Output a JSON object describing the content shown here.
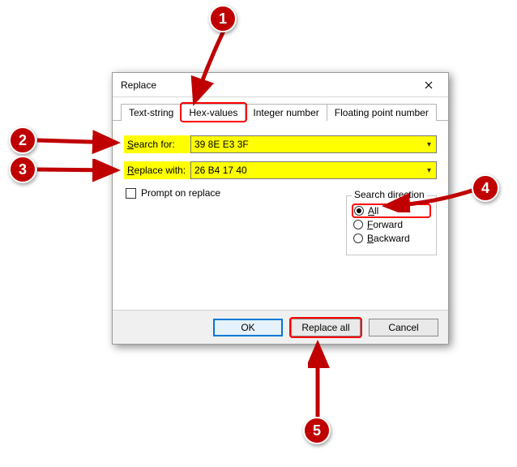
{
  "dialog": {
    "title": "Replace",
    "tabs": [
      {
        "label": "Text-string"
      },
      {
        "label": "Hex-values"
      },
      {
        "label": "Integer number"
      },
      {
        "label": "Floating point number"
      }
    ],
    "search_label_prefix": "S",
    "search_label_rest": "earch for:",
    "search_value": "39 8E E3 3F",
    "replace_label_prefix": "R",
    "replace_label_rest": "eplace with:",
    "replace_value": "26 B4 17 40",
    "prompt_label": "Prompt on replace",
    "prompt_checked": false,
    "direction": {
      "legend": "Search direction",
      "all_label": "All",
      "all_ul": "A",
      "forward_label": "orward",
      "forward_ul": "F",
      "backward_label": "ackward",
      "backward_ul": "B",
      "selected": "all"
    },
    "buttons": {
      "ok": "OK",
      "replace_all": "Replace all",
      "cancel": "Cancel"
    }
  },
  "annotations": {
    "m1": "1",
    "m2": "2",
    "m3": "3",
    "m4": "4",
    "m5": "5"
  }
}
